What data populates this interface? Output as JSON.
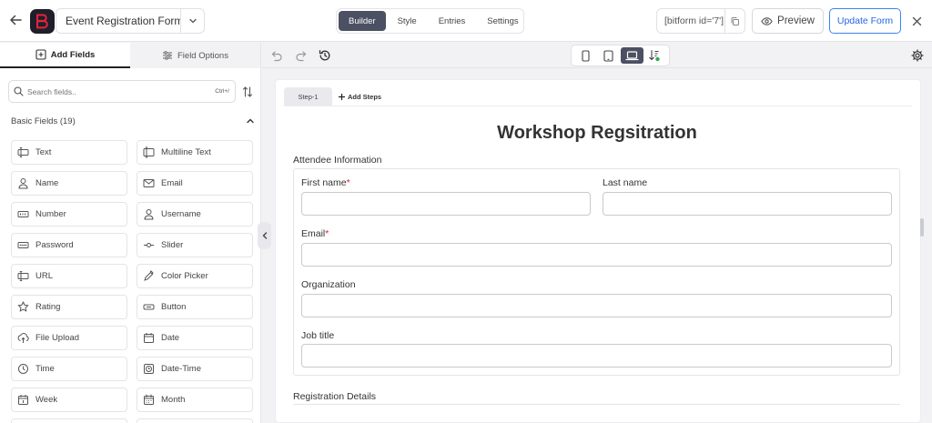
{
  "header": {
    "form_name": "Event Registration Form",
    "mode_tabs": [
      "Builder",
      "Style",
      "Entries",
      "Settings"
    ],
    "active_mode": "Builder",
    "shortcode": "[bitform id='7']",
    "preview_label": "Preview",
    "update_label": "Update Form"
  },
  "left_panel": {
    "tabs": {
      "add_fields": "Add Fields",
      "field_options": "Field Options"
    },
    "search": {
      "placeholder": "Search fields..",
      "shortcut": "Ctrl+/"
    },
    "group": {
      "title": "Basic Fields (19)"
    },
    "fields": [
      {
        "label": "Text",
        "icon": "text-icon"
      },
      {
        "label": "Multiline Text",
        "icon": "multiline-text-icon"
      },
      {
        "label": "Name",
        "icon": "person-icon"
      },
      {
        "label": "Email",
        "icon": "envelope-icon"
      },
      {
        "label": "Number",
        "icon": "number-icon"
      },
      {
        "label": "Username",
        "icon": "person-icon"
      },
      {
        "label": "Password",
        "icon": "password-icon"
      },
      {
        "label": "Slider",
        "icon": "slider-icon"
      },
      {
        "label": "URL",
        "icon": "url-icon"
      },
      {
        "label": "Color Picker",
        "icon": "color-picker-icon"
      },
      {
        "label": "Rating",
        "icon": "star-icon"
      },
      {
        "label": "Button",
        "icon": "button-icon"
      },
      {
        "label": "File Upload",
        "icon": "upload-icon"
      },
      {
        "label": "Date",
        "icon": "calendar-icon"
      },
      {
        "label": "Time",
        "icon": "clock-icon"
      },
      {
        "label": "Date-Time",
        "icon": "date-time-icon"
      },
      {
        "label": "Week",
        "icon": "week-calendar-icon"
      },
      {
        "label": "Month",
        "icon": "month-calendar-icon"
      }
    ]
  },
  "canvas": {
    "steps": {
      "current": "Step-1",
      "add_label": "Add Steps"
    },
    "title": "Workshop Regsitration",
    "sections": {
      "attendee": "Attendee Information",
      "registration": "Registration Details"
    },
    "form_fields": {
      "first_name": {
        "label": "First name",
        "required": "*"
      },
      "last_name": {
        "label": "Last name"
      },
      "email": {
        "label": "Email",
        "required": "*"
      },
      "organization": {
        "label": "Organization"
      },
      "job_title": {
        "label": "Job title"
      }
    }
  },
  "colors": {
    "accent_blue": "#2468e0",
    "active_dark": "#4b5163",
    "logo_red": "#e5233a",
    "required_red": "#d22233"
  }
}
